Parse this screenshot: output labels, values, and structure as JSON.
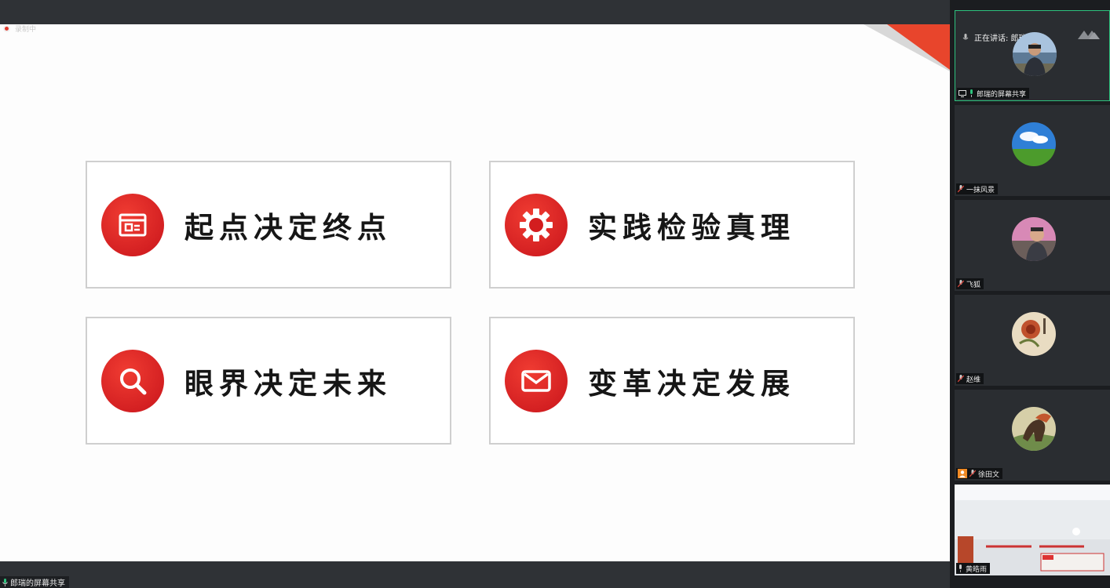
{
  "recording": {
    "label": "录制中"
  },
  "slide": {
    "cards": [
      {
        "label": "起点决定终点",
        "icon": "presentation-icon"
      },
      {
        "label": "实践检验真理",
        "icon": "gear-icon"
      },
      {
        "label": "眼界决定未来",
        "icon": "search-icon"
      },
      {
        "label": "变革决定发展",
        "icon": "envelope-icon"
      }
    ],
    "accent_color": "#e3231b"
  },
  "bottom": {
    "share_label": "郎瑞的屏幕共享"
  },
  "sidebar": {
    "speaking_text": "正在讲话: 郎瑞;",
    "participants": [
      {
        "name": "郎瑞的屏幕共享"
      },
      {
        "name": "一抹风景"
      },
      {
        "name": "飞狐"
      },
      {
        "name": "赵维"
      },
      {
        "name": "徐田文"
      },
      {
        "name": "黄皓雨"
      }
    ]
  }
}
